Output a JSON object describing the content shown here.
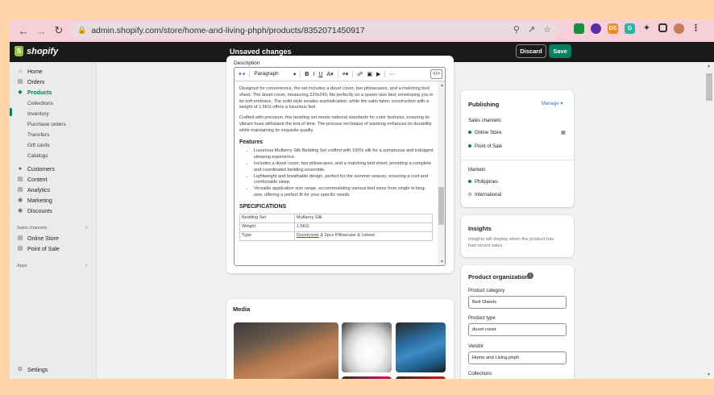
{
  "browser": {
    "url": "admin.shopify.com/store/home-and-living-phph/products/8352071450917",
    "extensions": [
      {
        "label": "",
        "color": "#1e8e3e"
      },
      {
        "label": "",
        "color": "#5b2da8"
      },
      {
        "label": "DS",
        "color": "#f08c24"
      },
      {
        "label": "G",
        "color": "#2ab5a5"
      },
      {
        "label": "",
        "color": "#333333"
      },
      {
        "label": "",
        "color": "#333333"
      }
    ]
  },
  "topbar": {
    "brand": "shopify",
    "status": "Unsaved changes",
    "discard": "Discard",
    "save": "Save"
  },
  "sidebar": {
    "home": "Home",
    "orders": "Orders",
    "products": "Products",
    "collections": "Collections",
    "inventory": "Inventory",
    "purchase_orders": "Purchase orders",
    "transfers": "Transfers",
    "gift_cards": "Gift cards",
    "catalogs": "Catalogs",
    "customers": "Customers",
    "content": "Content",
    "analytics": "Analytics",
    "marketing": "Marketing",
    "discounts": "Discounts",
    "sales_channels": "Sales channels",
    "online_store": "Online Store",
    "point_of_sale": "Point of Sale",
    "apps": "Apps",
    "settings": "Settings"
  },
  "editor": {
    "label": "Description",
    "paragraph": "Paragraph",
    "p1": "Designed for convenience, the set includes a duvet cover, two pillowcases, and a matching bed sheet. The duvet cover, measuring 220x240, fits perfectly on a queen-size bed, enveloping you in its soft embrace. The solid style exudes sophistication, while the satin fabric construction with a weight of 1.5KG offers a luxurious feel.",
    "p2": "Crafted with precision, this bedding set meets national standards for color fastness, ensuring its vibrant hues withstand the test of time. The process technique of washing enhances its durability while maintaining its exquisite quality.",
    "features_heading": "Features",
    "features": [
      "Luxurious Mulberry Silk Bedding Set crafted with 100% silk for a sumptuous and indulgent sleeping experience.",
      "Includes a duvet cover, two pillowcases, and a matching bed sheet, providing a complete and coordinated bedding ensemble.",
      "Lightweight and breathable design, perfect for the summer season, ensuring a cool and comfortable sleep.",
      "Versatile application size range, accommodating various bed sizes from single to king-size, offering a perfect fit for your specific needs."
    ],
    "specs_heading": "SPECIFICATIONS",
    "specs": [
      {
        "key": "Bedding Set",
        "value": "Mulberry Silk"
      },
      {
        "key": "Weight",
        "value": "1.5KG"
      },
      {
        "key": "Type",
        "value_u": "Duvetcover",
        "value_rest": " & 2pcs Pillowcase & 1sheet"
      }
    ]
  },
  "media": {
    "title": "Media"
  },
  "publishing": {
    "title": "Publishing",
    "manage": "Manage",
    "sales_channels_label": "Sales channels",
    "online_store": "Online Store",
    "point_of_sale": "Point of Sale",
    "markets_label": "Markets",
    "philippines": "Philippines",
    "international": "International"
  },
  "insights": {
    "title": "Insights",
    "text": "Insights will display when the product has had recent sales"
  },
  "organization": {
    "title": "Product organization",
    "category_label": "Product category",
    "category_value": "Bed Sheets",
    "type_label": "Product type",
    "type_value": "duvet cover",
    "vendor_label": "Vendor",
    "vendor_value": "Home and Living.phph",
    "collections_label": "Collections",
    "collections_value": ""
  }
}
